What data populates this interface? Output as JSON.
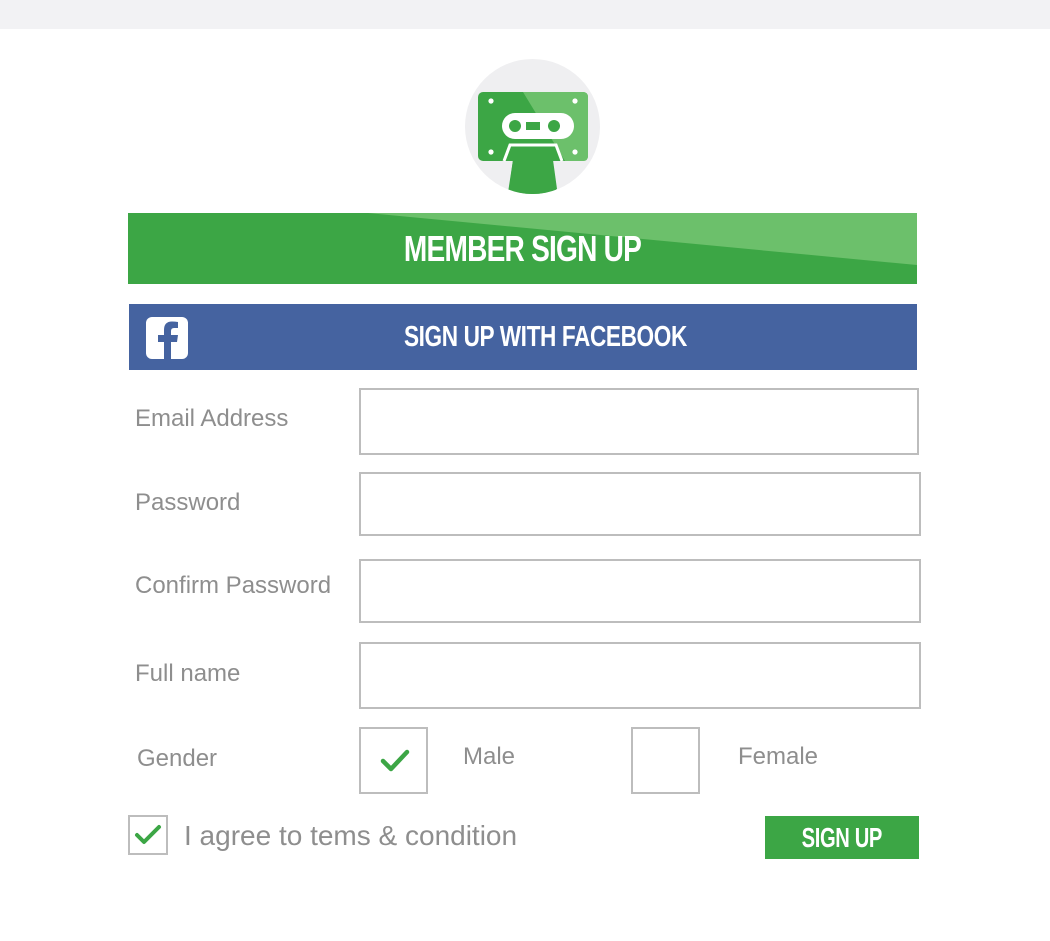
{
  "logo": {
    "icon": "cassette-tape-icon",
    "accent_color": "#3ca645"
  },
  "banner": {
    "title": "MEMBER SIGN UP"
  },
  "facebook": {
    "label": "SIGN UP WITH FACEBOOK",
    "icon": "facebook-icon",
    "color": "#4563a0"
  },
  "form": {
    "email": {
      "label": "Email Address",
      "value": ""
    },
    "password": {
      "label": "Password",
      "value": ""
    },
    "confirm_password": {
      "label": "Confirm Password",
      "value": ""
    },
    "full_name": {
      "label": "Full name",
      "value": ""
    },
    "gender": {
      "label": "Gender",
      "options": [
        {
          "label": "Male",
          "checked": true
        },
        {
          "label": "Female",
          "checked": false
        }
      ]
    },
    "terms": {
      "label": "I agree to tems & condition",
      "checked": true
    },
    "submit_label": "SIGN UP"
  }
}
